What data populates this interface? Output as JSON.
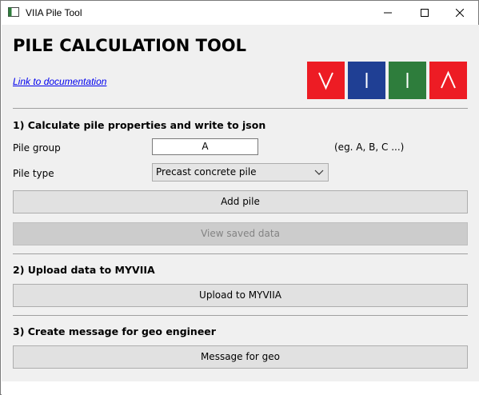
{
  "window": {
    "title": "VIIA Pile Tool",
    "controls": {
      "minimize_icon": "minimize-icon",
      "maximize_icon": "maximize-icon",
      "close_icon": "close-icon"
    }
  },
  "header": {
    "app_title": "PILE CALCULATION TOOL",
    "doc_link": "Link to documentation",
    "logo_letters": [
      "V",
      "I",
      "I",
      "Λ"
    ],
    "logo_colors": [
      "#ed1c24",
      "#1f3f94",
      "#2e7d3c",
      "#ed1c24"
    ]
  },
  "section1": {
    "heading": "1) Calculate pile properties and write to json",
    "pile_group_label": "Pile group",
    "pile_group_value": "A",
    "pile_group_hint": "(eg. A, B, C ...)",
    "pile_type_label": "Pile type",
    "pile_type_value": "Precast concrete pile",
    "add_pile_label": "Add pile",
    "view_saved_label": "View saved data"
  },
  "section2": {
    "heading": "2) Upload data to MYVIIA",
    "upload_label": "Upload to MYVIIA"
  },
  "section3": {
    "heading": "3) Create message for geo engineer",
    "message_label": "Message for geo"
  }
}
